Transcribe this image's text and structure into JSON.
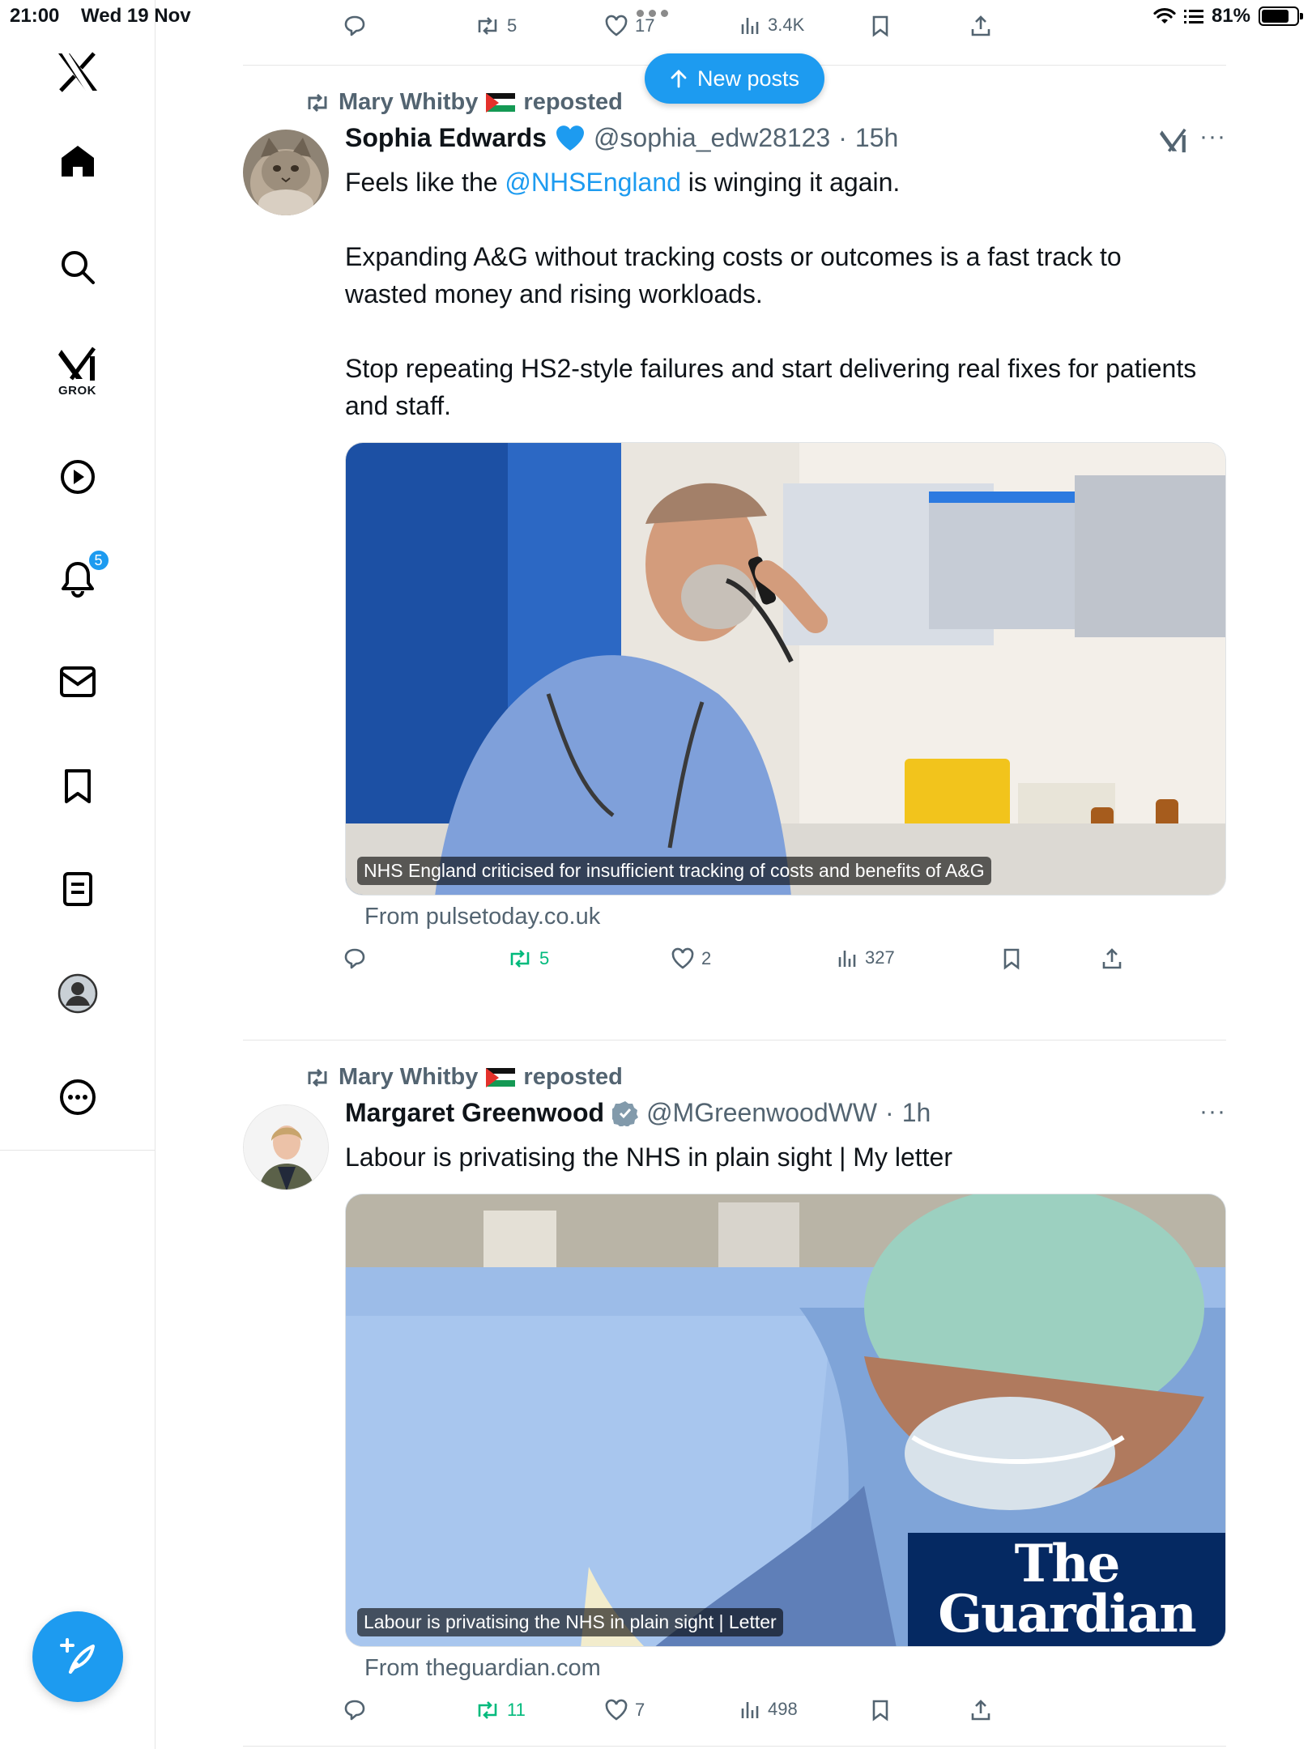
{
  "status_bar": {
    "time": "21:00",
    "date": "Wed 19 Nov",
    "battery": "81%",
    "battery_level": 0.81
  },
  "sidebar": {
    "grok_label": "GROK",
    "notifications_count": "5",
    "icons": [
      "x-logo",
      "home-icon",
      "search-icon",
      "grok-icon",
      "video-icon",
      "bell-icon",
      "mail-icon",
      "bookmark-icon",
      "lists-icon",
      "profile-icon",
      "more-icon"
    ],
    "accent": "#1d9bf0"
  },
  "new_posts": {
    "label": "New posts"
  },
  "prev_post_actions": {
    "reposts": "5",
    "likes": "17",
    "views": "3.4K"
  },
  "posts": [
    {
      "reposter": "Mary Whitby",
      "reposted_label": "reposted",
      "author": "Sophia Edwards",
      "handle": "@sophia_edw28123",
      "time": "15h",
      "text_1_pre": "Feels like the ",
      "text_1_mention": "@NHSEngland",
      "text_1_post": " is winging it again.",
      "text_2": "Expanding A&G without tracking costs or outcomes is a fast track to wasted money and rising workloads.",
      "text_3": "Stop repeating HS2-style failures and start delivering real fixes for patients and staff.",
      "card_caption": "NHS England criticised for insufficient tracking of costs and benefits of A&G",
      "card_source": "From pulsetoday.co.uk",
      "reposts": "5",
      "likes": "2",
      "views": "327"
    },
    {
      "reposter": "Mary Whitby",
      "reposted_label": "reposted",
      "author": "Margaret Greenwood",
      "handle": "@MGreenwoodWW",
      "time": "1h",
      "text_1": "Labour is privatising the NHS in plain sight | My letter",
      "card_caption": "Labour is privatising the NHS in plain sight | Letter",
      "card_logo_line1": "The",
      "card_logo_line2": "Guardian",
      "card_source": "From theguardian.com",
      "reposts": "11",
      "likes": "7",
      "views": "498"
    }
  ],
  "colors": {
    "accent": "#1d9bf0",
    "repost_green": "#00ba7c",
    "muted": "#536471",
    "verified_gray": "#829aab",
    "heart_blue": "#1d9bf0"
  }
}
